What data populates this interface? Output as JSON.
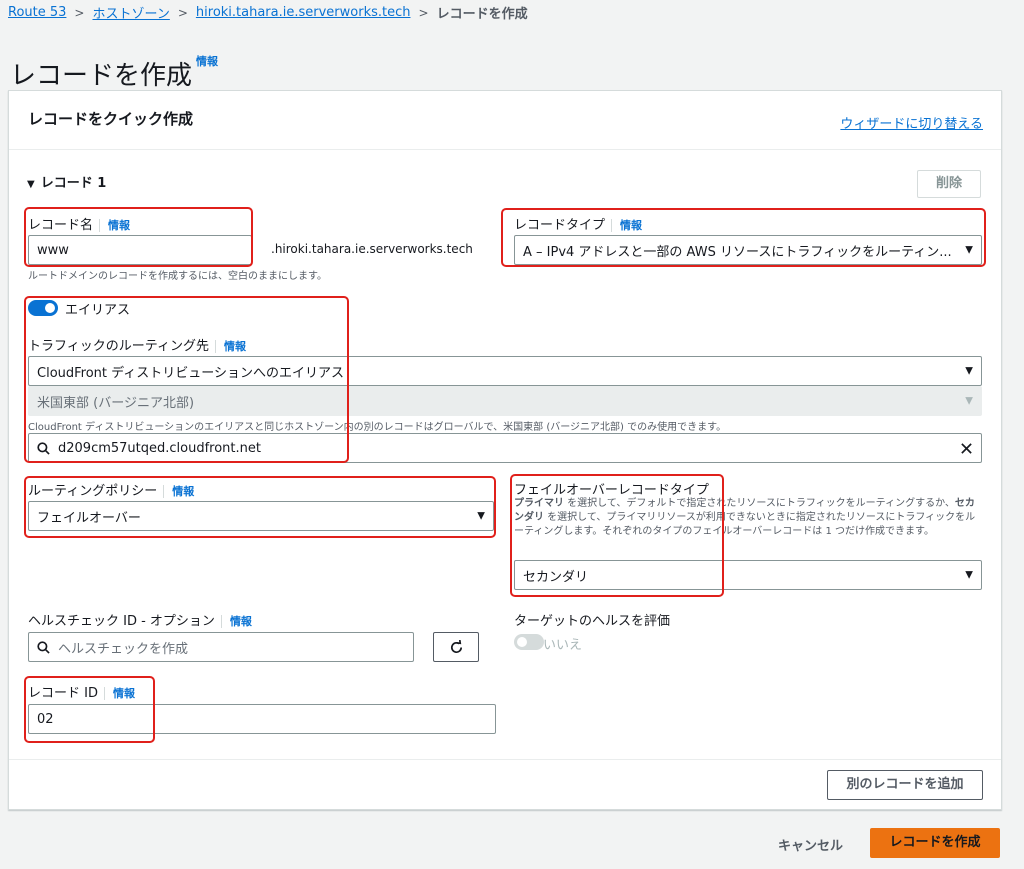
{
  "breadcrumb": {
    "items": [
      "Route 53",
      "ホストゾーン",
      "hiroki.tahara.ie.serverworks.tech"
    ],
    "current": "レコードを作成"
  },
  "page": {
    "title": "レコードを作成",
    "info": "情報"
  },
  "panel": {
    "title": "レコードをクイック作成",
    "wizard_link": "ウィザードに切り替える",
    "section_label": "レコード 1",
    "delete_button": "削除"
  },
  "record_name": {
    "label": "レコード名",
    "info": "情報",
    "value": "www",
    "suffix": ".hiroki.tahara.ie.serverworks.tech",
    "hint": "ルートドメインのレコードを作成するには、空白のままにします。"
  },
  "record_type": {
    "label": "レコードタイプ",
    "info": "情報",
    "value": "A – IPv4 アドレスと一部の AWS リソースにトラフィックをルーティン..."
  },
  "alias": {
    "label": "エイリアス",
    "enabled": true
  },
  "routing_target": {
    "label": "トラフィックのルーティング先",
    "info": "情報",
    "endpoint": "CloudFront ディストリビューションへのエイリアス",
    "region": "米国東部 (バージニア北部)",
    "hint": "CloudFront ディストリビューションのエイリアスと同じホストゾーン内の別のレコードはグローバルで、米国東部 (バージニア北部) でのみ使用できます。",
    "search_value": "d209cm57utqed.cloudfront.net"
  },
  "routing_policy": {
    "label": "ルーティングポリシー",
    "info": "情報",
    "value": "フェイルオーバー"
  },
  "failover_type": {
    "label": "フェイルオーバーレコードタイプ",
    "desc_primary": "プライマリ",
    "desc_1": " を選択して、デフォルトで指定されたリソースにトラフィックをルーティングするか、",
    "desc_secondary": "セカンダリ",
    "desc_2": " を選択して、プライマリリソースが利用できないときに指定されたリソースにトラフィックをルーティングします。それぞれのタイプのフェイルオーバーレコードは 1 つだけ作成できます。",
    "value": "セカンダリ"
  },
  "health_check": {
    "label": "ヘルスチェック ID - オプション",
    "info": "情報",
    "placeholder": "ヘルスチェックを作成"
  },
  "evaluate_health": {
    "label": "ターゲットのヘルスを評価",
    "value": "いいえ",
    "enabled": false
  },
  "record_id": {
    "label": "レコード ID",
    "info": "情報",
    "value": "02"
  },
  "add_record_button": "別のレコードを追加",
  "footer": {
    "cancel": "キャンセル",
    "create": "レコードを作成"
  },
  "colors": {
    "primary": "#ec7211",
    "link": "#0972d3",
    "toggle_on": "#0972d3",
    "highlight": "#e0201b"
  }
}
